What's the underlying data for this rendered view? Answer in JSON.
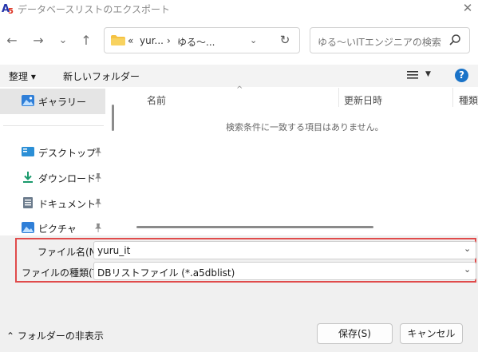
{
  "window": {
    "title": "データベースリストのエクスポート",
    "close_glyph": "✕"
  },
  "nav": {
    "back_glyph": "←",
    "forward_glyph": "→",
    "recent_glyph": "⌄",
    "up_glyph": "↑",
    "address_prefix": "«",
    "breadcrumb": [
      "yur...",
      "ゆる～..."
    ],
    "breadcrumb_sep": "›",
    "address_chevron": "⌄",
    "refresh_glyph": "↻",
    "search_placeholder": "ゆる～いITエンジニアの検索"
  },
  "toolbar": {
    "organize": "整理 ▾",
    "new_folder": "新しいフォルダー",
    "view_caret": "▼",
    "help": "?"
  },
  "sidebar": {
    "items": [
      {
        "label": "ギャラリー",
        "icon": "gallery-icon",
        "pinned": false,
        "selected": true
      },
      {
        "label": "デスクトップ",
        "icon": "desktop-icon",
        "pinned": true,
        "selected": false
      },
      {
        "label": "ダウンロード",
        "icon": "download-icon",
        "pinned": true,
        "selected": false
      },
      {
        "label": "ドキュメント",
        "icon": "document-icon",
        "pinned": true,
        "selected": false
      },
      {
        "label": "ピクチャ",
        "icon": "pictures-icon",
        "pinned": true,
        "selected": false
      }
    ],
    "pin_glyph": "📌"
  },
  "filelist": {
    "columns": [
      "名前",
      "更新日時",
      "種類"
    ],
    "sort_glyph": "^",
    "empty_message": "検索条件に一致する項目はありません。"
  },
  "form": {
    "filename_label": "ファイル名(N):",
    "filename_value": "yuru_it",
    "filetype_label": "ファイルの種類(T):",
    "filetype_value": "DBリストファイル (*.a5dblist)",
    "chevron": "⌄"
  },
  "footer": {
    "hide_folders": "フォルダーの非表示",
    "hide_folders_glyph": "⌃",
    "save": "保存(S)",
    "cancel": "キャンセル"
  },
  "colors": {
    "highlight_frame": "#e04b4b",
    "help_blue": "#1a73c8",
    "folder_yellow": "#f5c242"
  }
}
